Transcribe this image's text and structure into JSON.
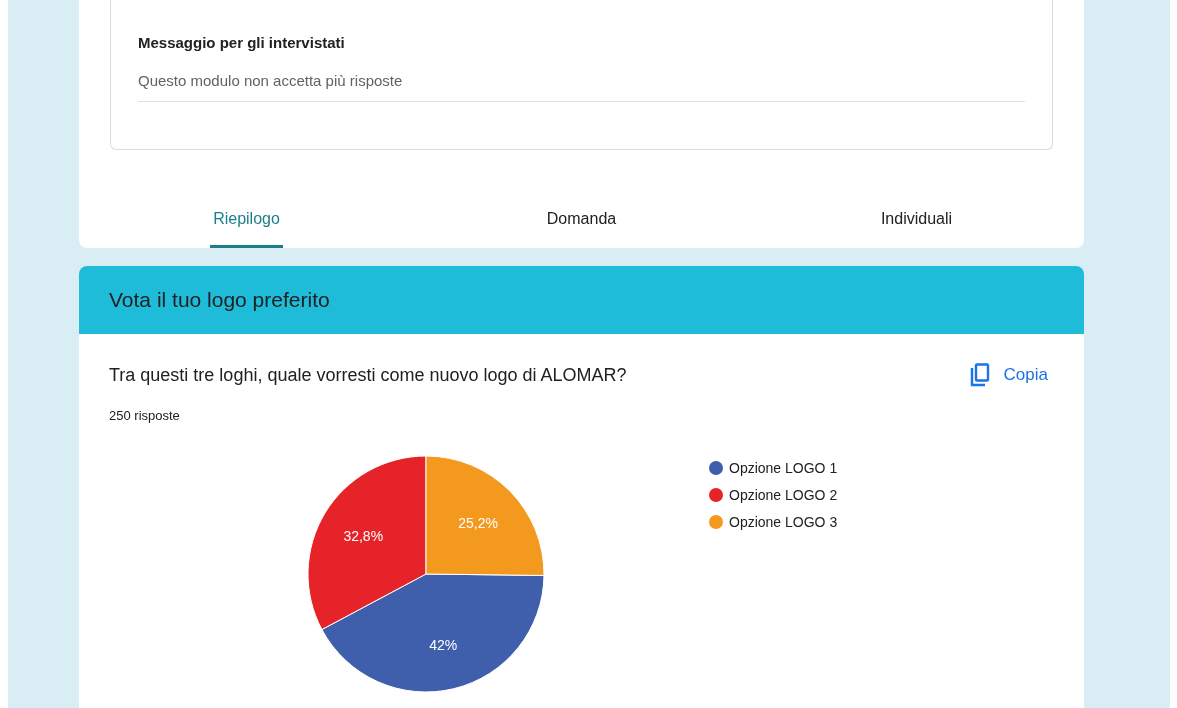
{
  "settings_card": {
    "field_label": "Messaggio per gli intervistati",
    "field_value": "Questo modulo non accetta più risposte"
  },
  "tabs": [
    {
      "label": "Riepilogo",
      "selected": true
    },
    {
      "label": "Domanda",
      "selected": false
    },
    {
      "label": "Individuali",
      "selected": false
    }
  ],
  "section": {
    "title": "Vota il tuo logo preferito"
  },
  "question": {
    "text": "Tra questi tre loghi, quale vorresti come nuovo logo di ALOMAR?",
    "copy_button": "Copia",
    "response_count": "250 risposte",
    "chart_data": {
      "type": "pie",
      "categories": [
        "Opzione LOGO 1",
        "Opzione LOGO 2",
        "Opzione LOGO 3"
      ],
      "series": [
        {
          "values": [
            42,
            32.8,
            25.2
          ]
        }
      ],
      "colors": [
        "#3f5fad",
        "#e52328",
        "#f39a1e"
      ],
      "value_labels": [
        "42%",
        "32,8%",
        "25,2%"
      ]
    }
  }
}
